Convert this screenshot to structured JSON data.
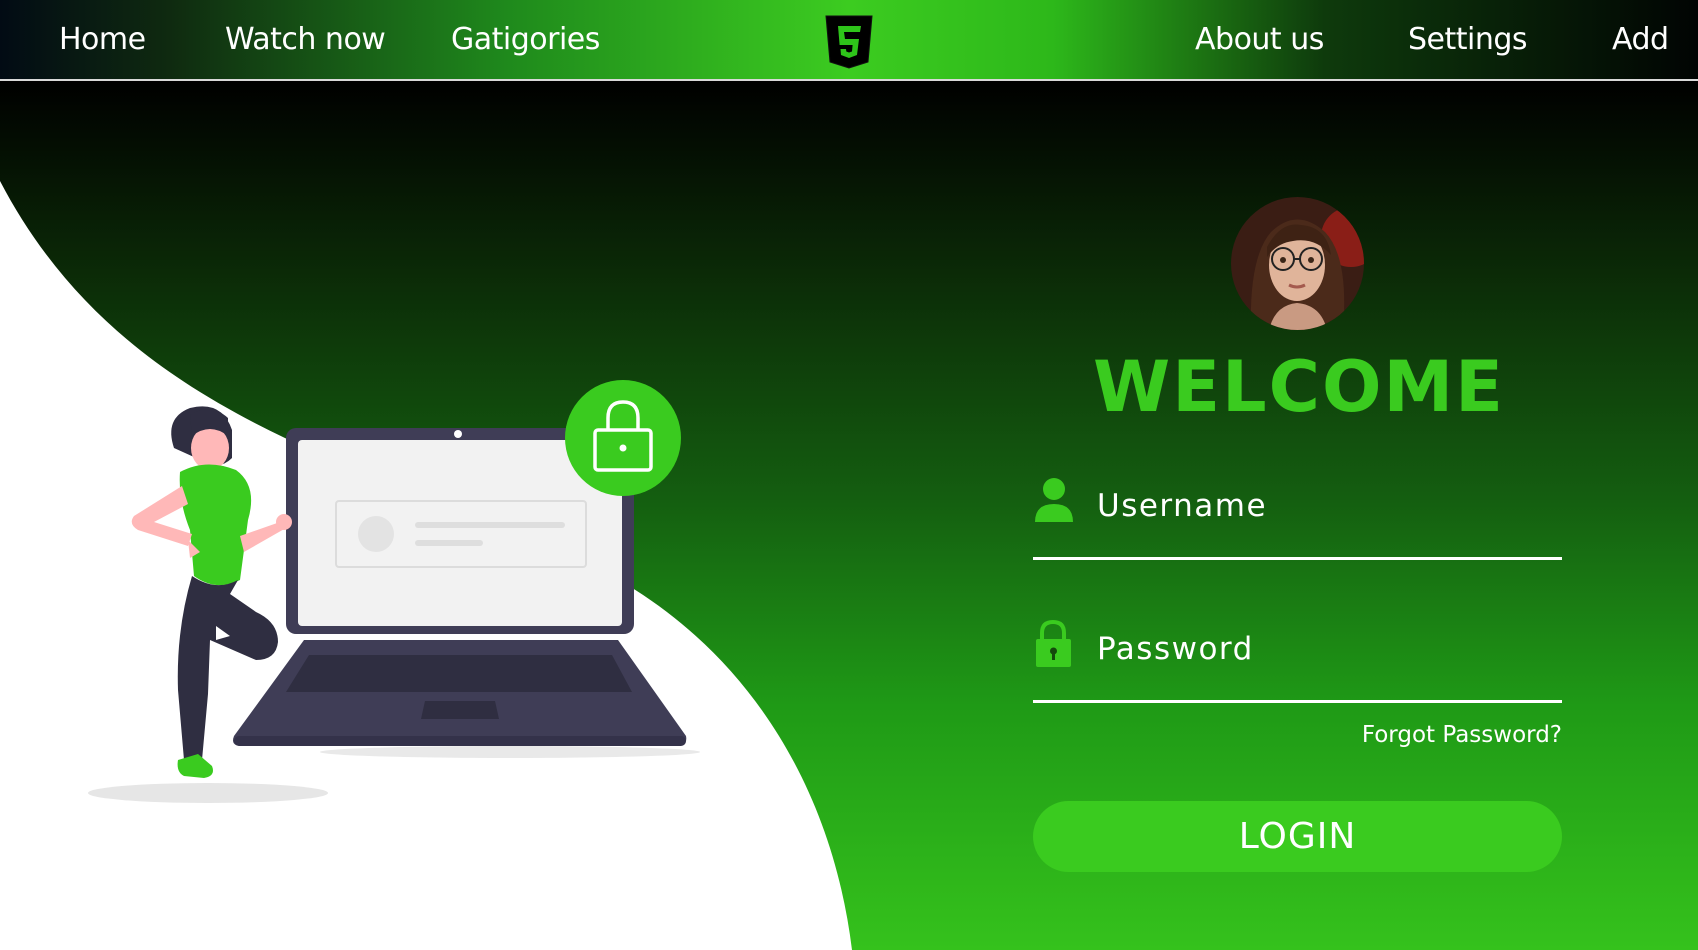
{
  "nav": {
    "left_links": [
      "Home",
      "Watch now",
      "Gatigories"
    ],
    "right_links": [
      "About us",
      "Settings",
      "Add"
    ],
    "logo_icon": "html5-logo-icon"
  },
  "login": {
    "avatar_icon": "user-avatar-photo",
    "title": "WELCOME",
    "username_label": "Username",
    "username_icon": "user-icon",
    "password_label": "Password",
    "password_icon": "lock-icon",
    "forgot_label": "Forgot Password?",
    "button_label": "LOGIN"
  },
  "illustration": {
    "name": "woman-with-laptop-illustration",
    "lock_icon": "padlock-icon"
  },
  "colors": {
    "accent": "#3acb1f",
    "dark": "#000000",
    "laptop": "#3f3d56",
    "text": "#ffffff"
  }
}
